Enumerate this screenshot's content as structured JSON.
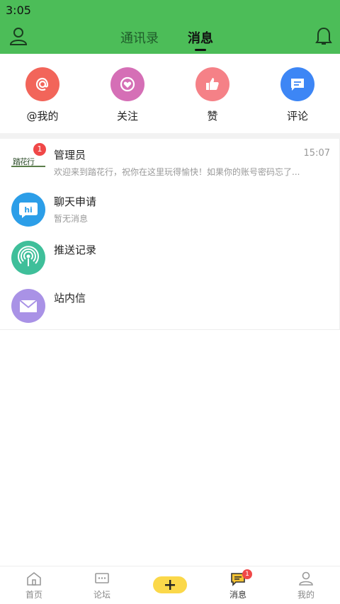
{
  "status_bar": {
    "time": "3:05"
  },
  "header": {
    "tabs": [
      {
        "label": "通讯录",
        "active": false
      },
      {
        "label": "消息",
        "active": true
      }
    ],
    "accent_color": "#4cbd58"
  },
  "quick_actions": [
    {
      "label": "@我的",
      "icon": "at-icon",
      "color": "#f2655a"
    },
    {
      "label": "关注",
      "icon": "heart-circle-icon",
      "color": "#d56fb6"
    },
    {
      "label": "赞",
      "icon": "thumbs-up-icon",
      "color": "#f58187"
    },
    {
      "label": "评论",
      "icon": "comment-icon",
      "color": "#3d86f5"
    }
  ],
  "messages": [
    {
      "title": "管理员",
      "subtitle": "欢迎来到踏花行，祝你在这里玩得愉快！如果你的账号密码忘了...",
      "time": "15:07",
      "badge": "1",
      "avatar": "site-logo",
      "logo_text": "踏花行"
    },
    {
      "title": "聊天申请",
      "subtitle": "暂无消息",
      "avatar": "hi-chat-icon",
      "color": "#2c9ee8"
    },
    {
      "title": "推送记录",
      "subtitle": "",
      "avatar": "broadcast-icon",
      "color": "#3fbf9a"
    },
    {
      "title": "站内信",
      "subtitle": "",
      "avatar": "mail-icon",
      "color": "#a992e6"
    }
  ],
  "bottom_nav": [
    {
      "label": "首页",
      "icon": "home-icon"
    },
    {
      "label": "论坛",
      "icon": "forum-icon"
    },
    {
      "label": "",
      "icon": "plus-icon",
      "color": "#fbd84a"
    },
    {
      "label": "消息",
      "icon": "message-icon",
      "badge": "1",
      "active": true
    },
    {
      "label": "我的",
      "icon": "profile-icon"
    }
  ]
}
